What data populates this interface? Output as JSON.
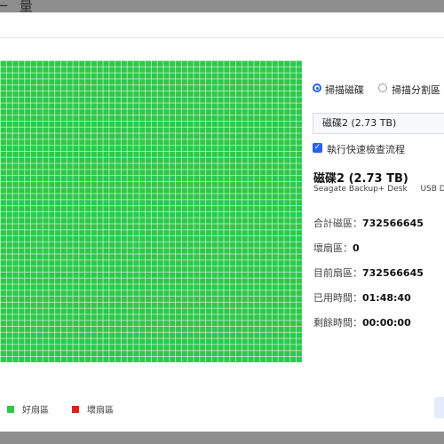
{
  "window": {
    "title_fragment": "一  量"
  },
  "legend": {
    "good_label": "好扇區",
    "bad_label": "壞扇區",
    "good_color": "#2ec84a",
    "bad_color": "#e02020"
  },
  "scan_mode": {
    "disk_label": "掃描磁碟",
    "partition_label": "掃描分割區",
    "selected": "disk"
  },
  "disk_select": {
    "value": "磁碟2 (2.73 TB)"
  },
  "quick_check": {
    "label": "執行快速檢查流程",
    "checked": true
  },
  "disk_info": {
    "name": "磁碟2 (2.73 TB)",
    "model": "Seagate  Backup+ Desk",
    "interface": "USB Dev"
  },
  "stats": {
    "total_label": "合計磁區：",
    "total_value": "732566645",
    "bad_label": "壞扇區：",
    "bad_value": "0",
    "current_label": "目前扇區：",
    "current_value": "732566645",
    "elapsed_label": "已用時間：",
    "elapsed_value": "01:48:40",
    "remaining_label": "剩餘時間：",
    "remaining_value": "00:00:00"
  }
}
